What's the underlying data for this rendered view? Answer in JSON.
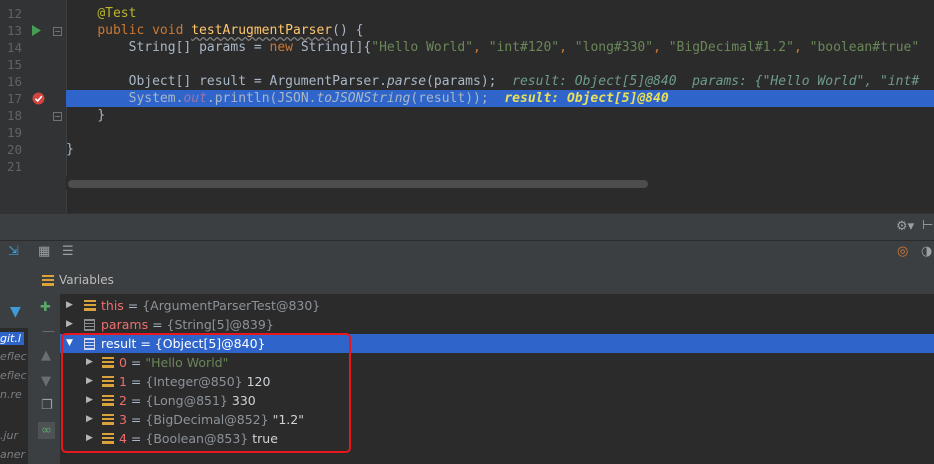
{
  "editor": {
    "line_numbers": [
      "12",
      "13",
      "14",
      "15",
      "16",
      "17",
      "18",
      "19",
      "20",
      "21"
    ],
    "code": {
      "annotation": "@Test",
      "l13_kw": "public void",
      "l13_method": "testArugmentParser",
      "l13_rest": "() {",
      "l14_type": "String[] params = ",
      "l14_new": "new",
      "l14_type2": " String[]{",
      "l14_s1": "\"Hello World\"",
      "l14_s2": "\"int#120\"",
      "l14_s3": "\"long#330\"",
      "l14_s4": "\"BigDecimal#1.2\"",
      "l14_s5": "\"boolean#true\"",
      "l16_code": "Object[] result = ArgumentParser.",
      "l16_method": "parse",
      "l16_end": "(params);",
      "l16_inline": "result: Object[5]@840  params: {\"Hello World\", \"int#",
      "l17_a": "System.",
      "l17_out": "out",
      "l17_b": ".println(JSON.",
      "l17_json": "toJSONString",
      "l17_c": "(result));",
      "l17_inline": "result: Object[5]@840",
      "l18": "}",
      "l20": "}"
    }
  },
  "frames": [
    "git.l",
    "eflec",
    "eflec",
    "n.re",
    ".jur",
    "aner"
  ],
  "variables": {
    "header": "Variables",
    "rows": [
      {
        "name": "this",
        "eq": " = ",
        "type": "{ArgumentParserTest@830}",
        "value": ""
      },
      {
        "name": "params",
        "eq": " = ",
        "type": "{String[5]@839}",
        "value": ""
      },
      {
        "name": "result",
        "eq": " = ",
        "type": "{Object[5]@840}",
        "value": ""
      },
      {
        "name": "0",
        "eq": " = ",
        "type": "",
        "value": "\"Hello World\""
      },
      {
        "name": "1",
        "eq": " = ",
        "type": "{Integer@850}",
        "value": " 120"
      },
      {
        "name": "2",
        "eq": " = ",
        "type": "{Long@851}",
        "value": " 330"
      },
      {
        "name": "3",
        "eq": " = ",
        "type": "{BigDecimal@852}",
        "value": " \"1.2\""
      },
      {
        "name": "4",
        "eq": " = ",
        "type": "{Boolean@853}",
        "value": " true"
      }
    ]
  },
  "colors": {
    "selection": "#2f65ca",
    "highlight_box": "#e8171b",
    "breakpoint": "#d0453e"
  }
}
